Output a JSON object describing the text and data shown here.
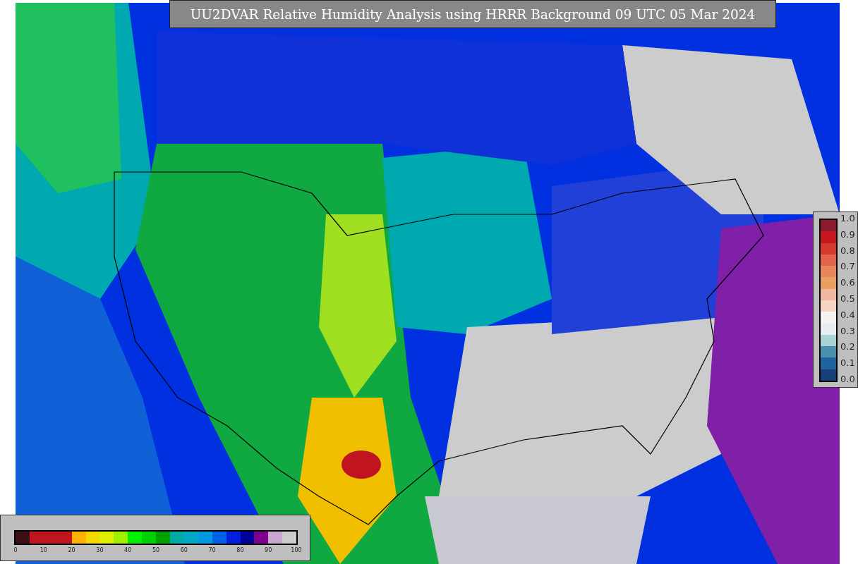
{
  "title": "UU2DVAR Relative Humidity Analysis using HRRR Background 09 UTC 05 Mar 2024",
  "colorbar_bottom": {
    "tick_labels": [
      "0",
      "10",
      "20",
      "30",
      "40",
      "50",
      "60",
      "70",
      "80",
      "90",
      "100"
    ],
    "segments": [
      {
        "color": "#3a1015"
      },
      {
        "color": "#c0151f"
      },
      {
        "color": "#c0151f"
      },
      {
        "color": "#c0151f"
      },
      {
        "color": "#ffb300"
      },
      {
        "color": "#f5d800"
      },
      {
        "color": "#e0ee00"
      },
      {
        "color": "#a0f000"
      },
      {
        "color": "#00f000"
      },
      {
        "color": "#00d000"
      },
      {
        "color": "#00a000"
      },
      {
        "color": "#00a8a8"
      },
      {
        "color": "#00a8c8"
      },
      {
        "color": "#0098e0"
      },
      {
        "color": "#0060e8"
      },
      {
        "color": "#0020e0"
      },
      {
        "color": "#00009a"
      },
      {
        "color": "#800090"
      },
      {
        "color": "#c8a8d0"
      },
      {
        "color": "#cccccc"
      }
    ]
  },
  "colorbar_right": {
    "tick_labels": [
      "1.0",
      "0.9",
      "0.8",
      "0.7",
      "0.6",
      "0.5",
      "0.4",
      "0.3",
      "0.2",
      "0.1",
      "0.0"
    ],
    "segments": [
      {
        "color": "#8b1a2e"
      },
      {
        "color": "#c8171f"
      },
      {
        "color": "#d63a2f"
      },
      {
        "color": "#e0634a"
      },
      {
        "color": "#e8855a"
      },
      {
        "color": "#e8a060"
      },
      {
        "color": "#f0b8a0"
      },
      {
        "color": "#f6d4c4"
      },
      {
        "color": "#f5f2ef"
      },
      {
        "color": "#e6eef1"
      },
      {
        "color": "#a8d3d2"
      },
      {
        "color": "#4b8faf"
      },
      {
        "color": "#1f64a0"
      },
      {
        "color": "#173f7a"
      }
    ]
  }
}
